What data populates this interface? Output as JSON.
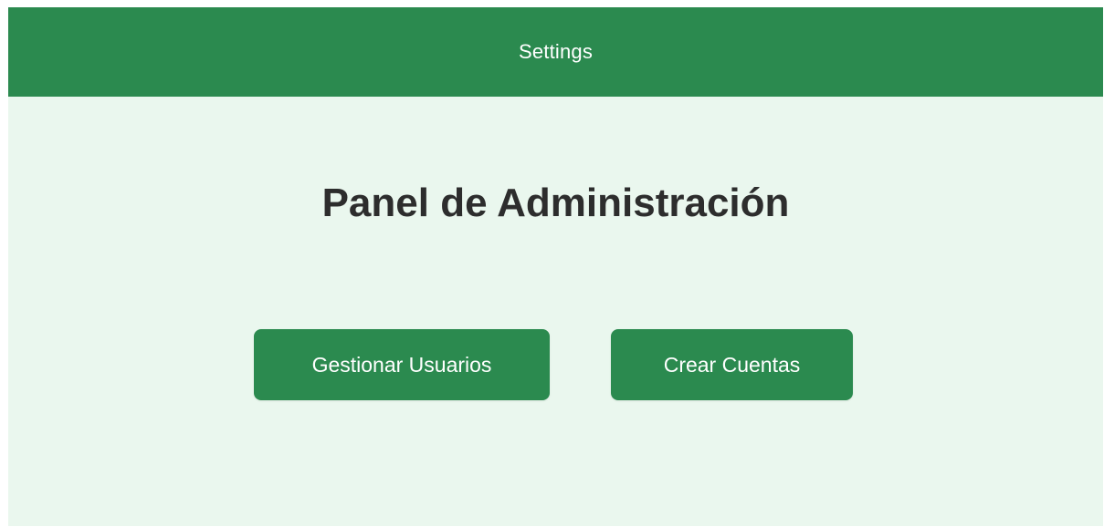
{
  "header": {
    "title": "Settings"
  },
  "main": {
    "title": "Panel de Administración",
    "buttons": {
      "manage_users": "Gestionar Usuarios",
      "create_accounts": "Crear Cuentas"
    }
  },
  "colors": {
    "primary": "#2b8a4f",
    "background": "#eaf7ee",
    "title_text": "#2d2d2d",
    "button_text": "#ffffff"
  }
}
